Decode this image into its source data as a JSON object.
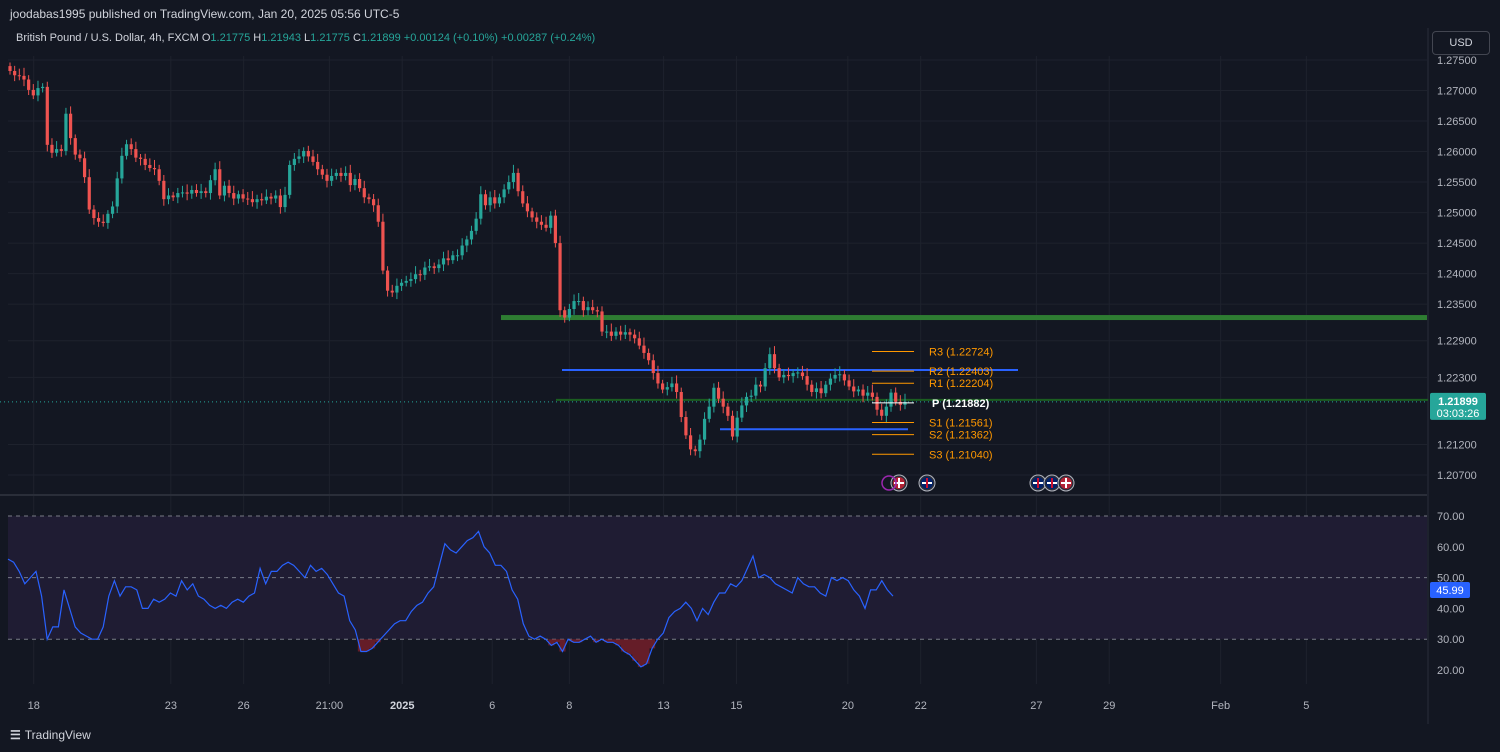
{
  "header": {
    "publish_line": "joodabas1995 published on TradingView.com, Jan 20, 2025 05:56 UTC-5"
  },
  "legend": {
    "symbol": "British Pound / U.S. Dollar, 4h, FXCM",
    "o_label": "O",
    "o_value": "1.21775",
    "h_label": "H",
    "h_value": "1.21943",
    "l_label": "L",
    "l_value": "1.21775",
    "c_label": "C",
    "c_value": "1.21899",
    "change1": "+0.00124 (+0.10%)",
    "change2": "+0.00287 (+0.24%)"
  },
  "currency_button": "USD",
  "footer": {
    "logo_text": "TradingView",
    "logo_glyph": "☰"
  },
  "colors": {
    "background": "#131722",
    "grid": "#1e222d",
    "up": "#26a69a",
    "down": "#ef5350",
    "rsi_line": "#2962ff",
    "rsi_band": "#1f1c33",
    "pivot_levels": "#ff9800",
    "support_resistance": "#2962ff",
    "zone_line": "#2e7d32"
  },
  "chart_data": [
    {
      "type": "candlestick",
      "title": "British Pound / U.S. Dollar, 4h, FXCM",
      "ylim": [
        1.204,
        1.2765
      ],
      "y_ticks": [
        "1.27500",
        "1.27000",
        "1.26500",
        "1.26000",
        "1.25500",
        "1.25000",
        "1.24500",
        "1.24000",
        "1.23500",
        "1.22900",
        "1.22300",
        "1.21200",
        "1.20700"
      ],
      "x_ticks": [
        "18",
        "23",
        "26",
        "21:00",
        "2025",
        "6",
        "8",
        "13",
        "15",
        "20",
        "22",
        "27",
        "29",
        "Feb",
        "5"
      ],
      "last_price": "1.21899",
      "countdown": "03:03:26",
      "closes": [
        1.2732,
        1.2725,
        1.2724,
        1.2718,
        1.2701,
        1.2692,
        1.2704,
        1.2706,
        1.2611,
        1.2598,
        1.2604,
        1.2601,
        1.2662,
        1.2622,
        1.2595,
        1.2589,
        1.2558,
        1.2505,
        1.2491,
        1.2485,
        1.2483,
        1.2498,
        1.251,
        1.2556,
        1.2593,
        1.2612,
        1.2604,
        1.259,
        1.2588,
        1.2578,
        1.2573,
        1.2571,
        1.2552,
        1.2522,
        1.2528,
        1.2525,
        1.2532,
        1.2533,
        1.2531,
        1.2537,
        1.2532,
        1.2535,
        1.2532,
        1.2553,
        1.2571,
        1.2528,
        1.2544,
        1.2532,
        1.2523,
        1.253,
        1.2523,
        1.2522,
        1.2517,
        1.2522,
        1.252,
        1.2526,
        1.2523,
        1.2528,
        1.2509,
        1.2529,
        1.2578,
        1.2588,
        1.2592,
        1.2601,
        1.2592,
        1.2583,
        1.2571,
        1.2562,
        1.2552,
        1.256,
        1.2565,
        1.256,
        1.2565,
        1.2545,
        1.2555,
        1.254,
        1.2525,
        1.2522,
        1.2512,
        1.2485,
        1.2405,
        1.2372,
        1.2369,
        1.238,
        1.2385,
        1.2388,
        1.2391,
        1.2399,
        1.2398,
        1.241,
        1.2412,
        1.2409,
        1.2415,
        1.2425,
        1.2422,
        1.243,
        1.243,
        1.2446,
        1.2456,
        1.247,
        1.249,
        1.253,
        1.2512,
        1.2525,
        1.2515,
        1.2525,
        1.2538,
        1.255,
        1.2565,
        1.2535,
        1.2515,
        1.2502,
        1.2492,
        1.2485,
        1.248,
        1.2475,
        1.2495,
        1.245,
        1.234,
        1.2328,
        1.2342,
        1.2355,
        1.2355,
        1.234,
        1.2345,
        1.234,
        1.2338,
        1.2305,
        1.2305,
        1.2298,
        1.2305,
        1.23,
        1.2304,
        1.23,
        1.2294,
        1.2282,
        1.227,
        1.2258,
        1.2237,
        1.222,
        1.221,
        1.2214,
        1.222,
        1.2206,
        1.2165,
        1.2135,
        1.2112,
        1.2109,
        1.2128,
        1.2162,
        1.2182,
        1.2213,
        1.2195,
        1.2182,
        1.2167,
        1.2133,
        1.2164,
        1.2184,
        1.2198,
        1.22,
        1.2218,
        1.2215,
        1.2245,
        1.2268,
        1.2245,
        1.223,
        1.2234,
        1.2232,
        1.2237,
        1.2238,
        1.2232,
        1.2218,
        1.2206,
        1.2212,
        1.2204,
        1.2218,
        1.2228,
        1.2234,
        1.2235,
        1.2225,
        1.2215,
        1.2207,
        1.221,
        1.22,
        1.2205,
        1.2198,
        1.2177,
        1.2167,
        1.2182,
        1.2205,
        1.219,
        1.2185,
        1.219
      ],
      "pivot_levels": [
        {
          "label": "R3 (1.22724)",
          "value": 1.22724
        },
        {
          "label": "R2 (1.22403)",
          "value": 1.22403
        },
        {
          "label": "R1 (1.22204)",
          "value": 1.22204
        },
        {
          "label": "P (1.21882)",
          "value": 1.21882
        },
        {
          "label": "S1 (1.21561)",
          "value": 1.21561
        },
        {
          "label": "S2 (1.21362)",
          "value": 1.21362
        },
        {
          "label": "S3 (1.21040)",
          "value": 1.2104
        }
      ],
      "zone_line_value": 1.2328,
      "resistance_line_value": 1.2242,
      "support_line_value": 1.2145
    },
    {
      "type": "line",
      "title": "",
      "ylim": [
        15,
        75
      ],
      "y_ticks": [
        "70.00",
        "60.00",
        "50.00",
        "40.00",
        "30.00",
        "20.00"
      ],
      "dashed_levels": [
        70,
        50,
        30
      ],
      "last_value": "45.99",
      "values": [
        56,
        55,
        52,
        48,
        50,
        52,
        44,
        30,
        34,
        34,
        46,
        40,
        34,
        32,
        31,
        30,
        30,
        34,
        44,
        49,
        44,
        47,
        47,
        46,
        40,
        40,
        43,
        42,
        43,
        45,
        44,
        49,
        46,
        48,
        44,
        43,
        41,
        40,
        41,
        40,
        42,
        43,
        42,
        44,
        45,
        53,
        48,
        52,
        52,
        54,
        55,
        54,
        52,
        50,
        54,
        52,
        53,
        51,
        48,
        45,
        44,
        36,
        33,
        26,
        26,
        27,
        29,
        31,
        33,
        35,
        36,
        36,
        39,
        41,
        42,
        45,
        47,
        54,
        61,
        59,
        58,
        60,
        62,
        63,
        65,
        60,
        58,
        54,
        54,
        52,
        46,
        43,
        35,
        31,
        30,
        31,
        30,
        28,
        29,
        26,
        30,
        29,
        29,
        30,
        31,
        29,
        30,
        29,
        29,
        28,
        26,
        25,
        23,
        21,
        22,
        27,
        30,
        32,
        37,
        39,
        40,
        42,
        40,
        36,
        40,
        38,
        42,
        45,
        45,
        48,
        47,
        49,
        53,
        57,
        50,
        51,
        50,
        48,
        47,
        46,
        45,
        50,
        48,
        47,
        47,
        45,
        44,
        50,
        49,
        50,
        49,
        46,
        44,
        40,
        46,
        46,
        49,
        46,
        44
      ]
    }
  ]
}
